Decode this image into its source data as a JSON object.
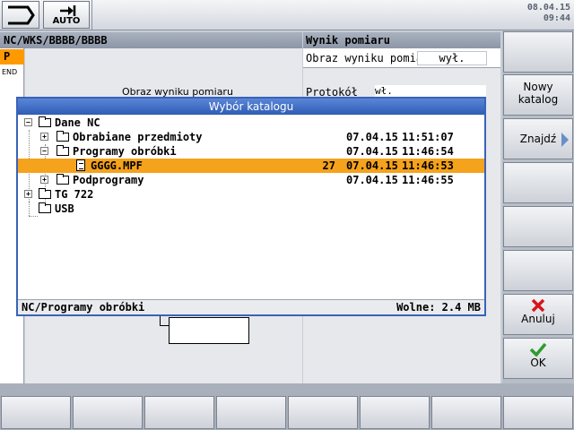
{
  "topbar": {
    "auto_label": "AUTO",
    "date": "08.04.15",
    "time": "09:44"
  },
  "header": {
    "path": "NC/WKS/BBBB/BBBB",
    "right_title": "Wynik pomiaru"
  },
  "side": {
    "mode": "P",
    "end_label": "END"
  },
  "main_left": {
    "partial_text": "Obraz wyniku pomiaru"
  },
  "main_right": {
    "row1_label": "Obraz wyniku pomiar",
    "row1_value": "wył.",
    "row2_label": "Protokół",
    "row2_value": "wł."
  },
  "dialog": {
    "title": "Wybór katalogu",
    "status_path": "NC/Programy obróbki",
    "status_free": "Wolne: 2.4 MB",
    "tree": [
      {
        "name": "Dane NC",
        "size": "",
        "date": "",
        "time": ""
      },
      {
        "name": "Obrabiane przedmioty",
        "size": "",
        "date": "07.04.15",
        "time": "11:51:07"
      },
      {
        "name": "Programy obróbki",
        "size": "",
        "date": "07.04.15",
        "time": "11:46:54"
      },
      {
        "name": "GGGG.MPF",
        "size": "27",
        "date": "07.04.15",
        "time": "11:46:53"
      },
      {
        "name": "Podprogramy",
        "size": "",
        "date": "07.04.15",
        "time": "11:46:55"
      },
      {
        "name": "TG 722",
        "size": "",
        "date": "",
        "time": ""
      },
      {
        "name": "USB",
        "size": "",
        "date": "",
        "time": ""
      }
    ]
  },
  "softkeys": {
    "new_catalog_line1": "Nowy",
    "new_catalog_line2": "katalog",
    "find": "Znajdź",
    "cancel": "Anuluj",
    "ok": "OK"
  },
  "colors": {
    "selection": "#f5a21c",
    "title_bar": "#2f5db4",
    "cancel_red": "#d8141a",
    "ok_green": "#2e9b2e"
  }
}
